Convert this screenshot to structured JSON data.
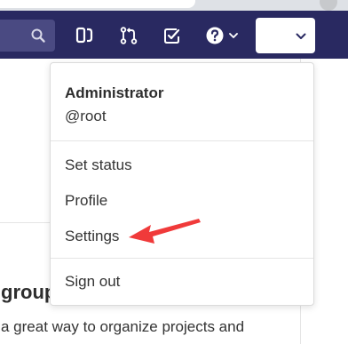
{
  "colors": {
    "navbar_bg": "#292961",
    "search_bg": "#4a4a82",
    "nav_icon": "#ffffff",
    "menu_border": "#dbdbdb",
    "annotation_arrow": "#f03a3a"
  },
  "navbar": {
    "icons": [
      "search-icon",
      "issues-icon",
      "merge-request-icon",
      "todo-icon",
      "help-icon",
      "chevron-down-icon"
    ],
    "user_button_icon": "chevron-down-icon"
  },
  "user_menu": {
    "name": "Administrator",
    "handle": "@root",
    "items": [
      {
        "label": "Set status"
      },
      {
        "label": "Profile"
      },
      {
        "label": "Settings"
      }
    ],
    "sign_out": "Sign out"
  },
  "page": {
    "heading_fragment": "group",
    "text_fragment": "a great way to organize projects and"
  }
}
